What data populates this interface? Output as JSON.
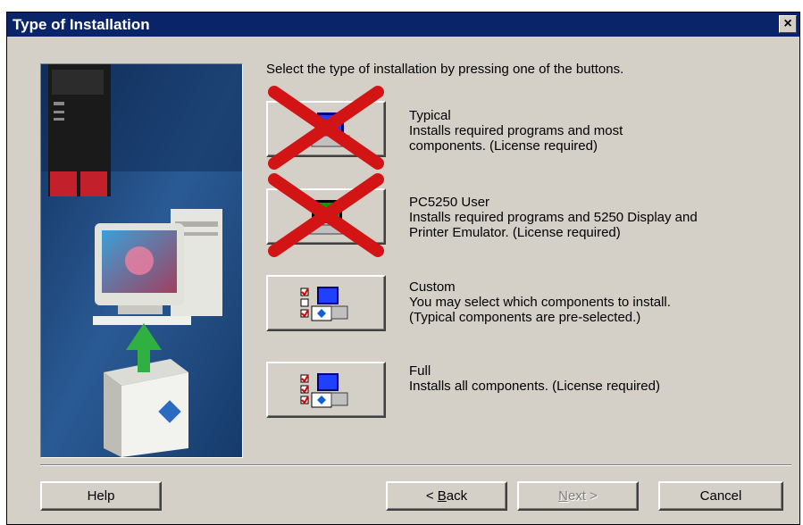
{
  "window": {
    "title": "Type of Installation",
    "close_label": "×"
  },
  "intro": "Select the type of installation by pressing one of the buttons.",
  "options": [
    {
      "name": "Typical",
      "desc1": "Installs required programs and most",
      "desc2": "components.  (License required)",
      "crossed_out": true
    },
    {
      "name": "PC5250 User",
      "desc1": "Installs required programs and 5250 Display and",
      "desc2": "Printer Emulator.  (License required)",
      "crossed_out": true
    },
    {
      "name": "Custom",
      "desc1": "You may select which components to install.",
      "desc2": "(Typical components are pre-selected.)",
      "crossed_out": false
    },
    {
      "name": "Full",
      "desc1": "Installs all components.  (License required)",
      "desc2": "",
      "crossed_out": false
    }
  ],
  "buttons": {
    "help": "Help",
    "back_key": "B",
    "back_rest": "ack",
    "next_key": "N",
    "next_rest": "ext >",
    "cancel": "Cancel"
  },
  "colors": {
    "titlebar": "#0a246a",
    "face": "#d4d0c8",
    "cross": "#d21414",
    "art_bg": "#1c3f6e"
  }
}
